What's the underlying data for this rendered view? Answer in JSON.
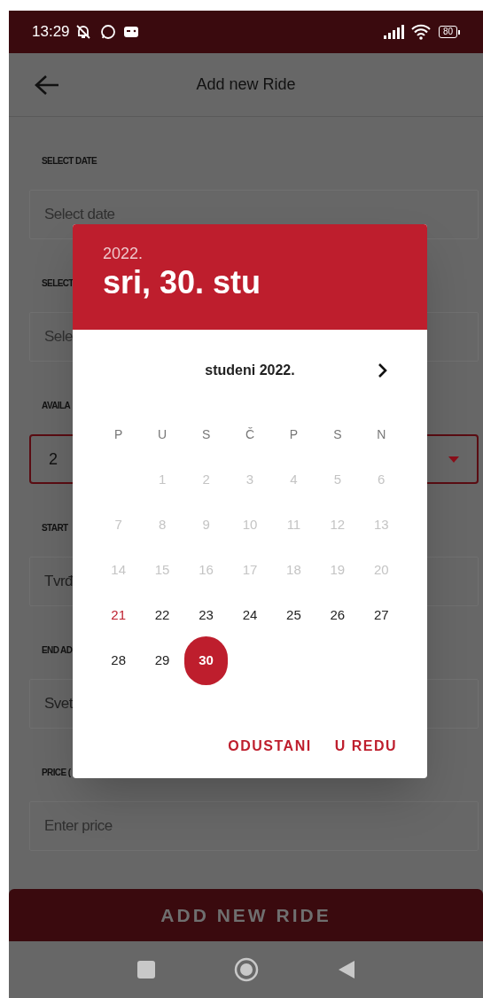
{
  "status_bar": {
    "time": "13:29",
    "battery": "80"
  },
  "app_bar": {
    "title": "Add new Ride"
  },
  "form": [
    {
      "kind": "field",
      "label": "SELECT DATE",
      "placeholder": "Select date"
    },
    {
      "kind": "field",
      "label": "SELECT",
      "placeholder": "Sele"
    },
    {
      "kind": "dropdown",
      "label": "AVAILA",
      "value": "2"
    },
    {
      "kind": "field",
      "label": "START",
      "value": "Tvrđ"
    },
    {
      "kind": "field",
      "label": "END AD",
      "value": "Svet"
    },
    {
      "kind": "field",
      "label": "PRICE (",
      "placeholder": "Enter price"
    }
  ],
  "submit_button": "ADD NEW RIDE",
  "date_picker": {
    "year": "2022.",
    "selected_date": "sri, 30. stu",
    "month": "studeni 2022.",
    "weekdays": [
      "P",
      "U",
      "S",
      "Č",
      "P",
      "S",
      "N"
    ],
    "days": [
      {
        "kind": "blank"
      },
      {
        "kind": "day",
        "label": "1",
        "disabled": true,
        "today": false,
        "selected": false
      },
      {
        "kind": "day",
        "label": "2",
        "disabled": true,
        "today": false,
        "selected": false
      },
      {
        "kind": "day",
        "label": "3",
        "disabled": true,
        "today": false,
        "selected": false
      },
      {
        "kind": "day",
        "label": "4",
        "disabled": true,
        "today": false,
        "selected": false
      },
      {
        "kind": "day",
        "label": "5",
        "disabled": true,
        "today": false,
        "selected": false
      },
      {
        "kind": "day",
        "label": "6",
        "disabled": true,
        "today": false,
        "selected": false
      },
      {
        "kind": "day",
        "label": "7",
        "disabled": true,
        "today": false,
        "selected": false
      },
      {
        "kind": "day",
        "label": "8",
        "disabled": true,
        "today": false,
        "selected": false
      },
      {
        "kind": "day",
        "label": "9",
        "disabled": true,
        "today": false,
        "selected": false
      },
      {
        "kind": "day",
        "label": "10",
        "disabled": true,
        "today": false,
        "selected": false
      },
      {
        "kind": "day",
        "label": "11",
        "disabled": true,
        "today": false,
        "selected": false
      },
      {
        "kind": "day",
        "label": "12",
        "disabled": true,
        "today": false,
        "selected": false
      },
      {
        "kind": "day",
        "label": "13",
        "disabled": true,
        "today": false,
        "selected": false
      },
      {
        "kind": "day",
        "label": "14",
        "disabled": true,
        "today": false,
        "selected": false
      },
      {
        "kind": "day",
        "label": "15",
        "disabled": true,
        "today": false,
        "selected": false
      },
      {
        "kind": "day",
        "label": "16",
        "disabled": true,
        "today": false,
        "selected": false
      },
      {
        "kind": "day",
        "label": "17",
        "disabled": true,
        "today": false,
        "selected": false
      },
      {
        "kind": "day",
        "label": "18",
        "disabled": true,
        "today": false,
        "selected": false
      },
      {
        "kind": "day",
        "label": "19",
        "disabled": true,
        "today": false,
        "selected": false
      },
      {
        "kind": "day",
        "label": "20",
        "disabled": true,
        "today": false,
        "selected": false
      },
      {
        "kind": "day",
        "label": "21",
        "disabled": false,
        "today": true,
        "selected": false
      },
      {
        "kind": "day",
        "label": "22",
        "disabled": false,
        "today": false,
        "selected": false
      },
      {
        "kind": "day",
        "label": "23",
        "disabled": false,
        "today": false,
        "selected": false
      },
      {
        "kind": "day",
        "label": "24",
        "disabled": false,
        "today": false,
        "selected": false
      },
      {
        "kind": "day",
        "label": "25",
        "disabled": false,
        "today": false,
        "selected": false
      },
      {
        "kind": "day",
        "label": "26",
        "disabled": false,
        "today": false,
        "selected": false
      },
      {
        "kind": "day",
        "label": "27",
        "disabled": false,
        "today": false,
        "selected": false
      },
      {
        "kind": "day",
        "label": "28",
        "disabled": false,
        "today": false,
        "selected": false
      },
      {
        "kind": "day",
        "label": "29",
        "disabled": false,
        "today": false,
        "selected": false
      },
      {
        "kind": "day",
        "label": "30",
        "disabled": false,
        "today": false,
        "selected": true
      }
    ],
    "buttons": [
      "ODUSTANI",
      "U REDU"
    ]
  }
}
